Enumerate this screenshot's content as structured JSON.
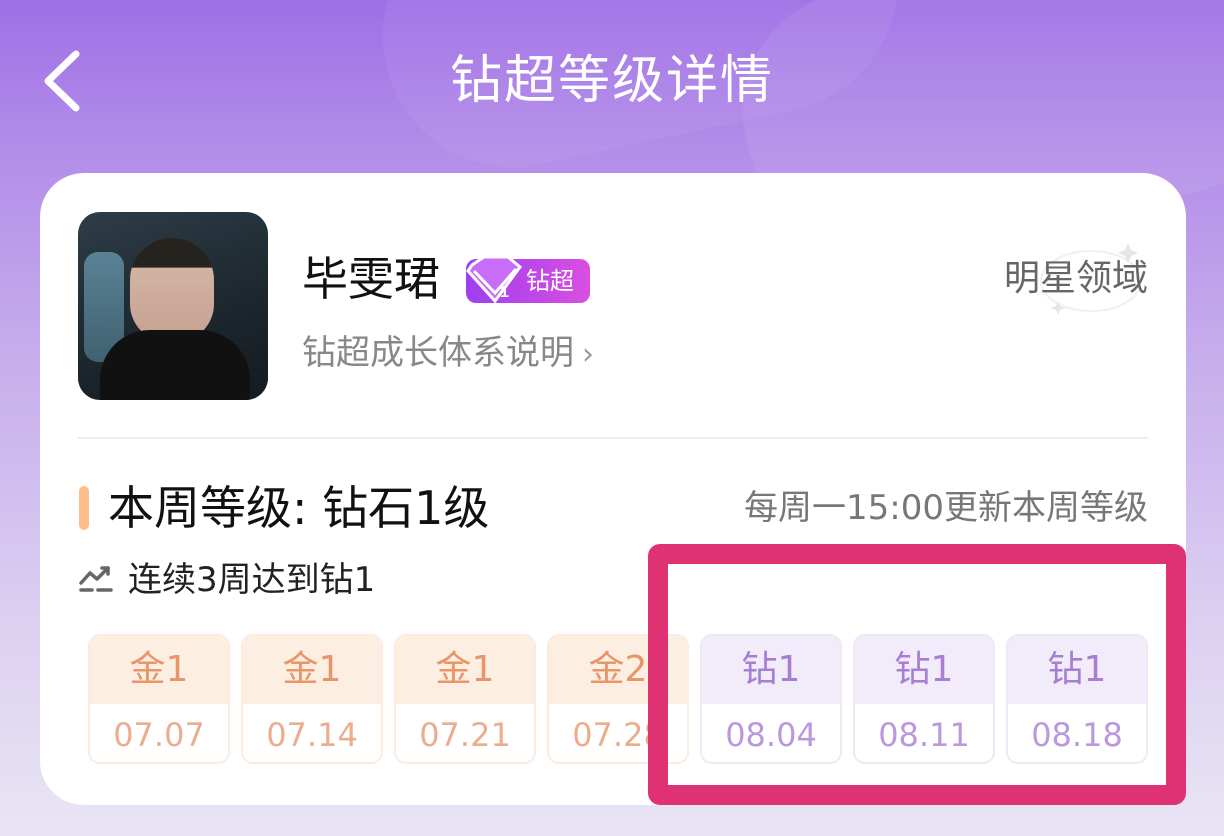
{
  "header": {
    "title": "钻超等级详情",
    "back_icon": "chevron-left-icon"
  },
  "profile": {
    "name": "毕雯珺",
    "badge_label": "钻超",
    "badge_colors": [
      "#9e3ff0",
      "#d94fe0"
    ],
    "realm_label": "明星领域",
    "growth_link": "钻超成长体系说明"
  },
  "level": {
    "current_label": "本周等级: 钻石1级",
    "update_note": "每周一15:00更新本周等级",
    "streak_text": "连续3周达到钻1"
  },
  "weeks": [
    {
      "level": "金1",
      "date": "07.07",
      "tier": "gold"
    },
    {
      "level": "金1",
      "date": "07.14",
      "tier": "gold"
    },
    {
      "level": "金1",
      "date": "07.21",
      "tier": "gold"
    },
    {
      "level": "金2",
      "date": "07.28",
      "tier": "gold"
    },
    {
      "level": "钻1",
      "date": "08.04",
      "tier": "diamond"
    },
    {
      "level": "钻1",
      "date": "08.11",
      "tier": "diamond"
    },
    {
      "level": "钻1",
      "date": "08.18",
      "tier": "diamond"
    }
  ],
  "colors": {
    "highlight": "#de3272",
    "gold": "#e8956a",
    "diamond": "#a67ed4",
    "accent_bar": "#ffbd8c"
  }
}
